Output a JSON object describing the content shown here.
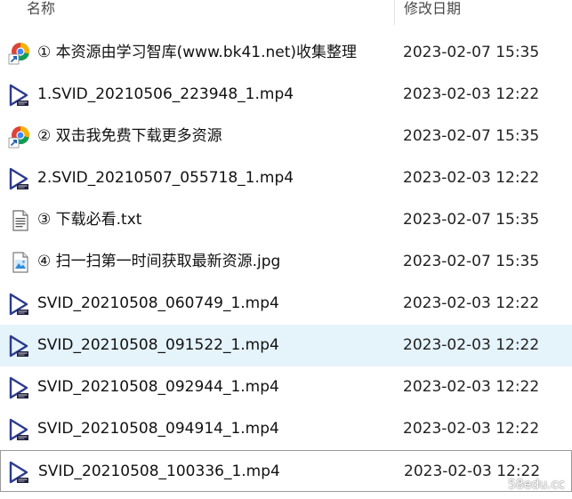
{
  "columns": {
    "name": "名称",
    "date_modified": "修改日期"
  },
  "files": [
    {
      "name": "① 本资源由学习智库(www.bk41.net)收集整理",
      "date": "2023-02-07 15:35",
      "icon": "url-shortcut-icon",
      "state": "normal"
    },
    {
      "name": "1.SVID_20210506_223948_1.mp4",
      "date": "2023-02-03 12:22",
      "icon": "video-file-icon",
      "state": "normal"
    },
    {
      "name": "② 双击我免费下载更多资源",
      "date": "2023-02-07 15:35",
      "icon": "url-shortcut-icon",
      "state": "normal"
    },
    {
      "name": "2.SVID_20210507_055718_1.mp4",
      "date": "2023-02-03 12:22",
      "icon": "video-file-icon",
      "state": "normal"
    },
    {
      "name": "③ 下载必看.txt",
      "date": "2023-02-07 15:35",
      "icon": "text-file-icon",
      "state": "normal"
    },
    {
      "name": "④ 扫一扫第一时间获取最新资源.jpg",
      "date": "2023-02-07 15:35",
      "icon": "image-file-icon",
      "state": "normal"
    },
    {
      "name": "SVID_20210508_060749_1.mp4",
      "date": "2023-02-03 12:22",
      "icon": "video-file-icon",
      "state": "normal"
    },
    {
      "name": "SVID_20210508_091522_1.mp4",
      "date": "2023-02-03 12:22",
      "icon": "video-file-icon",
      "state": "hover"
    },
    {
      "name": "SVID_20210508_092944_1.mp4",
      "date": "2023-02-03 12:22",
      "icon": "video-file-icon",
      "state": "normal"
    },
    {
      "name": "SVID_20210508_094914_1.mp4",
      "date": "2023-02-03 12:22",
      "icon": "video-file-icon",
      "state": "normal"
    },
    {
      "name": "SVID_20210508_100336_1.mp4",
      "date": "2023-02-03 12:22",
      "icon": "video-file-icon",
      "state": "selected"
    }
  ],
  "watermark": "58edu.cc",
  "colors": {
    "hover_bg": "#e5f3fb",
    "selected_border": "#9a9a9a",
    "video_icon": "#2b3a8f"
  }
}
